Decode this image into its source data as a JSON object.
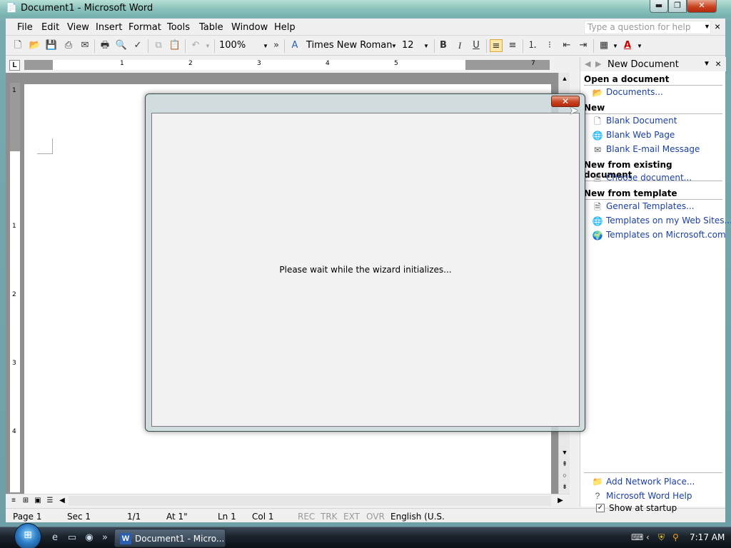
{
  "window": {
    "title": "Document1 - Microsoft Word",
    "app_icon": "word-icon",
    "min_glyph": "▬",
    "max_glyph": "❐",
    "close_glyph": "✕"
  },
  "menubar": {
    "items": [
      "File",
      "Edit",
      "View",
      "Insert",
      "Format",
      "Tools",
      "Table",
      "Window",
      "Help"
    ],
    "help_placeholder": "Type a question for help",
    "close_glyph": "×"
  },
  "toolbar": {
    "zoom": "100%",
    "font_name": "Times New Roman",
    "font_size": "12",
    "bold": "B",
    "italic": "I",
    "underline": "U",
    "font_color_glyph": "A",
    "font_color": "#cc0000"
  },
  "ruler": {
    "tab_selector": "L",
    "numbers": [
      "1",
      "2",
      "3",
      "4",
      "5",
      "7"
    ],
    "vnumbers": [
      "1",
      "1",
      "2",
      "3",
      "4"
    ]
  },
  "statusbar": {
    "page": "Page 1",
    "sec": "Sec 1",
    "pages": "1/1",
    "at": "At 1\"",
    "ln": "Ln 1",
    "col": "Col 1",
    "rec": "REC",
    "trk": "TRK",
    "ext": "EXT",
    "ovr": "OVR",
    "language": "English (U.S."
  },
  "taskpane": {
    "title": "New Document",
    "sections": {
      "open": "Open a document",
      "new": "New",
      "existing": "New from existing document",
      "template": "New from template"
    },
    "links": {
      "documents": "Documents...",
      "blank_document": "Blank Document",
      "blank_web_page": "Blank Web Page",
      "blank_email": "Blank E-mail Message",
      "choose_document": "Choose document...",
      "general_templates": "General Templates...",
      "templates_web_sites": "Templates on my Web Sites...",
      "templates_microsoft": "Templates on Microsoft.com",
      "add_network_place": "Add Network Place...",
      "word_help": "Microsoft Word Help"
    },
    "show_at_startup": "Show at startup",
    "show_at_startup_checked": true
  },
  "dialog": {
    "message": "Please wait while the wizard initializes...",
    "close_glyph": "✕"
  },
  "taskbar": {
    "word_button": "Document1 - Micro...",
    "clock": "7:17 AM"
  }
}
